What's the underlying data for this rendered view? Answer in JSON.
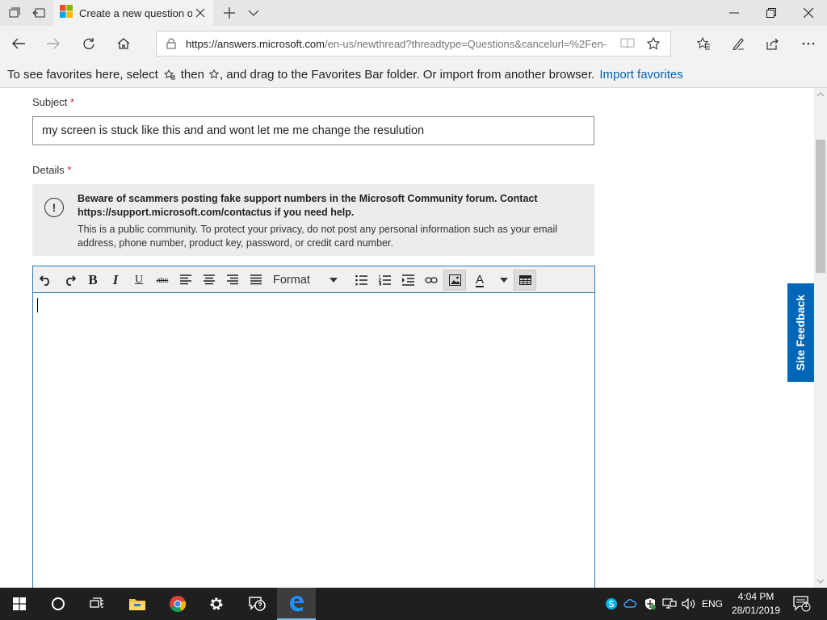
{
  "tab": {
    "title": "Create a new question or start a discussion"
  },
  "address": {
    "url_host": "https://answers.microsoft.com",
    "url_path": "/en-us/newthread?threadtype=Questions&cancelurl=%2Fen-"
  },
  "favorites_bar": {
    "message_1": "To see favorites here, select",
    "message_2": "then",
    "message_3": ", and drag to the Favorites Bar folder. Or import from another browser.",
    "import_link": "Import favorites"
  },
  "form": {
    "subject_label": "Subject",
    "required_mark": "*",
    "subject_value": "my screen is stuck like this and and wont let me me change the resulution",
    "details_label": "Details",
    "warning_bold": "Beware of scammers posting fake support numbers in the Microsoft Community forum. Contact https://support.microsoft.com/contactus if you need help.",
    "warning_text": "This is a public community. To protect your privacy, do not post any personal information such as your email address, phone number, product key, password, or credit card number.",
    "warning_icon_glyph": "!"
  },
  "editor_toolbar": {
    "bold": "B",
    "italic": "I",
    "underline": "U",
    "strike": "abc",
    "format_label": "Format",
    "font_color": "A"
  },
  "site_feedback": "Site Feedback",
  "taskbar": {
    "language": "ENG",
    "time": "4:04 PM",
    "date": "28/01/2019",
    "notification_count": "1"
  },
  "colors": {
    "accent": "#0067b8",
    "required": "#c4262e",
    "link": "#0063b1",
    "editor_border": "#2d7ab7"
  }
}
